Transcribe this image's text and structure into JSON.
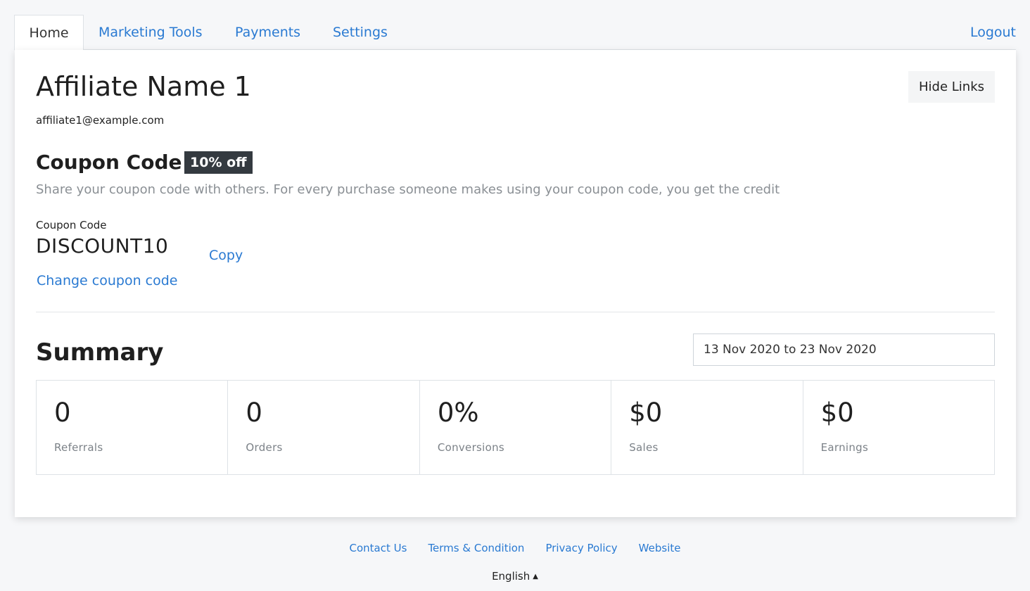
{
  "nav": {
    "tabs": [
      {
        "label": "Home",
        "active": true
      },
      {
        "label": "Marketing Tools",
        "active": false
      },
      {
        "label": "Payments",
        "active": false
      },
      {
        "label": "Settings",
        "active": false
      }
    ],
    "logout_label": "Logout"
  },
  "profile": {
    "name": "Affiliate Name 1",
    "email": "affiliate1@example.com",
    "hide_links_label": "Hide Links"
  },
  "coupon": {
    "heading": "Coupon Code",
    "badge": "10% off",
    "description": "Share your coupon code with others. For every purchase someone makes using your coupon code, you get the credit",
    "label": "Coupon Code",
    "code": "DISCOUNT10",
    "copy_label": "Copy",
    "change_label": "Change coupon code"
  },
  "summary": {
    "title": "Summary",
    "date_range": "13 Nov 2020 to 23 Nov 2020",
    "stats": [
      {
        "value": "0",
        "label": "Referrals"
      },
      {
        "value": "0",
        "label": "Orders"
      },
      {
        "value": "0%",
        "label": "Conversions"
      },
      {
        "value": "$0",
        "label": "Sales"
      },
      {
        "value": "$0",
        "label": "Earnings"
      }
    ]
  },
  "footer": {
    "links": [
      "Contact Us",
      "Terms & Condition",
      "Privacy Policy",
      "Website"
    ],
    "language": "English"
  },
  "colors": {
    "link": "#2a7ad2",
    "badge_bg": "#343a40",
    "page_bg": "#f6f7f9"
  },
  "icons": {
    "language_caret": "caret-up-icon"
  }
}
